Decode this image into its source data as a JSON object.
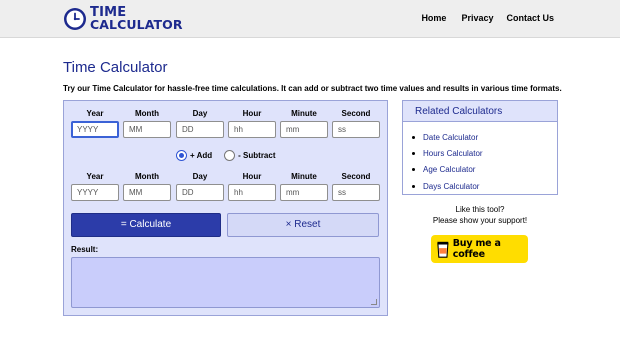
{
  "header": {
    "logo_line1": "TIME",
    "logo_line2": "CALCULATOR",
    "nav": {
      "home": "Home",
      "privacy": "Privacy",
      "contact": "Contact Us"
    }
  },
  "page": {
    "title": "Time Calculator",
    "intro": "Try our Time Calculator for hassle-free time calculations. It can add or subtract two time values and results in various time formats."
  },
  "calculator": {
    "columns": [
      "Year",
      "Month",
      "Day",
      "Hour",
      "Minute",
      "Second"
    ],
    "placeholders": [
      "YYYY",
      "MM",
      "DD",
      "hh",
      "mm",
      "ss"
    ],
    "operation": {
      "add_label": "+ Add",
      "subtract_label": "- Subtract",
      "selected": "add"
    },
    "calculate_label": "= Calculate",
    "reset_label": "× Reset",
    "result_label": "Result:"
  },
  "related": {
    "heading": "Related Calculators",
    "items": [
      "Date Calculator",
      "Hours Calculator",
      "Age Calculator",
      "Days Calculator"
    ]
  },
  "support": {
    "line1": "Like this tool?",
    "line2": "Please show your support!",
    "coffee_label": "Buy me a coffee"
  },
  "colors": {
    "brand": "#1d2a8e",
    "accent": "#2c3ca9",
    "panel": "#dfe3fb",
    "coffee": "#ffdd00"
  }
}
